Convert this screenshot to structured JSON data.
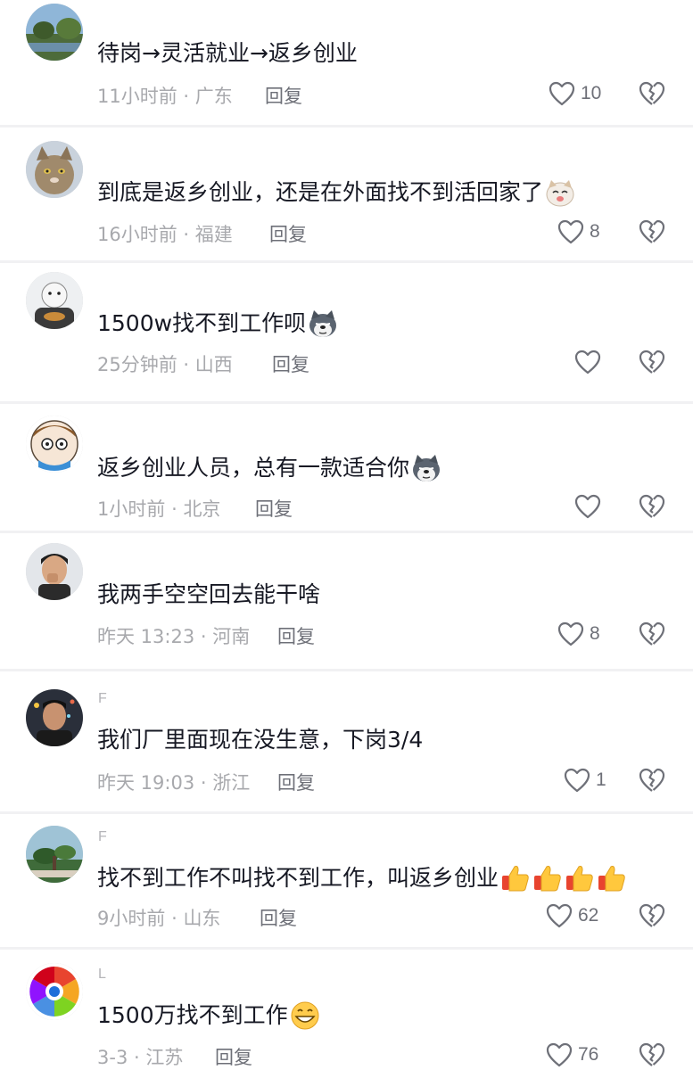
{
  "comments": [
    {
      "username": "",
      "text": "待岗→灵活就业→返乡创业",
      "emoji": "",
      "time": "11小时前",
      "location": "广东",
      "reply": "回复",
      "likes": "10"
    },
    {
      "username": "",
      "text": "到底是返乡创业，还是在外面找不到活回家了",
      "emoji": "cat-face-emoji",
      "time": "16小时前",
      "location": "福建",
      "reply": "回复",
      "likes": "8"
    },
    {
      "username": "",
      "text": "1500w找不到工作呗",
      "emoji": "husky-face-emoji",
      "time": "25分钟前",
      "location": "山西",
      "reply": "回复",
      "likes": ""
    },
    {
      "username": "",
      "text": "返乡创业人员，总有一款适合你",
      "emoji": "husky-face-emoji",
      "time": "1小时前",
      "location": "北京",
      "reply": "回复",
      "likes": ""
    },
    {
      "username": "",
      "text": "我两手空空回去能干啥",
      "emoji": "",
      "time": "昨天 13:23",
      "location": "河南",
      "reply": "回复",
      "likes": "8"
    },
    {
      "username": "F",
      "text": "我们厂里面现在没生意，下岗3/4",
      "emoji": "",
      "time": "昨天 19:03",
      "location": "浙江",
      "reply": "回复",
      "likes": "1"
    },
    {
      "username": "F",
      "text": "找不到工作不叫找不到工作，叫返乡创业",
      "emoji": "thumbs-up-emoji-x4",
      "time": "9小时前",
      "location": "山东",
      "reply": "回复",
      "likes": "62"
    },
    {
      "username": "L",
      "text": "1500万找不到工作",
      "emoji": "grin-face-emoji",
      "time": "3-3",
      "location": "江苏",
      "reply": "回复",
      "likes": "76"
    }
  ],
  "separator": "·",
  "colors": {
    "text": "#161823",
    "meta": "#a8a9ad",
    "action": "#6e7078",
    "separator": "#f1f1f3"
  }
}
